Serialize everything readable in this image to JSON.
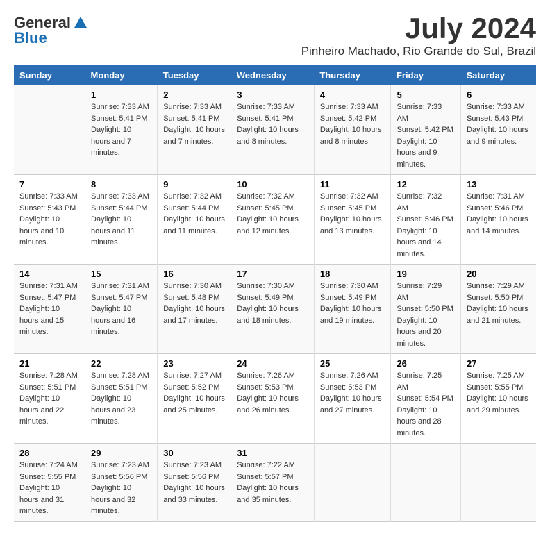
{
  "logo": {
    "general": "General",
    "blue": "Blue"
  },
  "title": {
    "month": "July 2024",
    "location": "Pinheiro Machado, Rio Grande do Sul, Brazil"
  },
  "headers": [
    "Sunday",
    "Monday",
    "Tuesday",
    "Wednesday",
    "Thursday",
    "Friday",
    "Saturday"
  ],
  "weeks": [
    [
      {
        "day": "",
        "sunrise": "",
        "sunset": "",
        "daylight": ""
      },
      {
        "day": "1",
        "sunrise": "Sunrise: 7:33 AM",
        "sunset": "Sunset: 5:41 PM",
        "daylight": "Daylight: 10 hours and 7 minutes."
      },
      {
        "day": "2",
        "sunrise": "Sunrise: 7:33 AM",
        "sunset": "Sunset: 5:41 PM",
        "daylight": "Daylight: 10 hours and 7 minutes."
      },
      {
        "day": "3",
        "sunrise": "Sunrise: 7:33 AM",
        "sunset": "Sunset: 5:41 PM",
        "daylight": "Daylight: 10 hours and 8 minutes."
      },
      {
        "day": "4",
        "sunrise": "Sunrise: 7:33 AM",
        "sunset": "Sunset: 5:42 PM",
        "daylight": "Daylight: 10 hours and 8 minutes."
      },
      {
        "day": "5",
        "sunrise": "Sunrise: 7:33 AM",
        "sunset": "Sunset: 5:42 PM",
        "daylight": "Daylight: 10 hours and 9 minutes."
      },
      {
        "day": "6",
        "sunrise": "Sunrise: 7:33 AM",
        "sunset": "Sunset: 5:43 PM",
        "daylight": "Daylight: 10 hours and 9 minutes."
      }
    ],
    [
      {
        "day": "7",
        "sunrise": "Sunrise: 7:33 AM",
        "sunset": "Sunset: 5:43 PM",
        "daylight": "Daylight: 10 hours and 10 minutes."
      },
      {
        "day": "8",
        "sunrise": "Sunrise: 7:33 AM",
        "sunset": "Sunset: 5:44 PM",
        "daylight": "Daylight: 10 hours and 11 minutes."
      },
      {
        "day": "9",
        "sunrise": "Sunrise: 7:32 AM",
        "sunset": "Sunset: 5:44 PM",
        "daylight": "Daylight: 10 hours and 11 minutes."
      },
      {
        "day": "10",
        "sunrise": "Sunrise: 7:32 AM",
        "sunset": "Sunset: 5:45 PM",
        "daylight": "Daylight: 10 hours and 12 minutes."
      },
      {
        "day": "11",
        "sunrise": "Sunrise: 7:32 AM",
        "sunset": "Sunset: 5:45 PM",
        "daylight": "Daylight: 10 hours and 13 minutes."
      },
      {
        "day": "12",
        "sunrise": "Sunrise: 7:32 AM",
        "sunset": "Sunset: 5:46 PM",
        "daylight": "Daylight: 10 hours and 14 minutes."
      },
      {
        "day": "13",
        "sunrise": "Sunrise: 7:31 AM",
        "sunset": "Sunset: 5:46 PM",
        "daylight": "Daylight: 10 hours and 14 minutes."
      }
    ],
    [
      {
        "day": "14",
        "sunrise": "Sunrise: 7:31 AM",
        "sunset": "Sunset: 5:47 PM",
        "daylight": "Daylight: 10 hours and 15 minutes."
      },
      {
        "day": "15",
        "sunrise": "Sunrise: 7:31 AM",
        "sunset": "Sunset: 5:47 PM",
        "daylight": "Daylight: 10 hours and 16 minutes."
      },
      {
        "day": "16",
        "sunrise": "Sunrise: 7:30 AM",
        "sunset": "Sunset: 5:48 PM",
        "daylight": "Daylight: 10 hours and 17 minutes."
      },
      {
        "day": "17",
        "sunrise": "Sunrise: 7:30 AM",
        "sunset": "Sunset: 5:49 PM",
        "daylight": "Daylight: 10 hours and 18 minutes."
      },
      {
        "day": "18",
        "sunrise": "Sunrise: 7:30 AM",
        "sunset": "Sunset: 5:49 PM",
        "daylight": "Daylight: 10 hours and 19 minutes."
      },
      {
        "day": "19",
        "sunrise": "Sunrise: 7:29 AM",
        "sunset": "Sunset: 5:50 PM",
        "daylight": "Daylight: 10 hours and 20 minutes."
      },
      {
        "day": "20",
        "sunrise": "Sunrise: 7:29 AM",
        "sunset": "Sunset: 5:50 PM",
        "daylight": "Daylight: 10 hours and 21 minutes."
      }
    ],
    [
      {
        "day": "21",
        "sunrise": "Sunrise: 7:28 AM",
        "sunset": "Sunset: 5:51 PM",
        "daylight": "Daylight: 10 hours and 22 minutes."
      },
      {
        "day": "22",
        "sunrise": "Sunrise: 7:28 AM",
        "sunset": "Sunset: 5:51 PM",
        "daylight": "Daylight: 10 hours and 23 minutes."
      },
      {
        "day": "23",
        "sunrise": "Sunrise: 7:27 AM",
        "sunset": "Sunset: 5:52 PM",
        "daylight": "Daylight: 10 hours and 25 minutes."
      },
      {
        "day": "24",
        "sunrise": "Sunrise: 7:26 AM",
        "sunset": "Sunset: 5:53 PM",
        "daylight": "Daylight: 10 hours and 26 minutes."
      },
      {
        "day": "25",
        "sunrise": "Sunrise: 7:26 AM",
        "sunset": "Sunset: 5:53 PM",
        "daylight": "Daylight: 10 hours and 27 minutes."
      },
      {
        "day": "26",
        "sunrise": "Sunrise: 7:25 AM",
        "sunset": "Sunset: 5:54 PM",
        "daylight": "Daylight: 10 hours and 28 minutes."
      },
      {
        "day": "27",
        "sunrise": "Sunrise: 7:25 AM",
        "sunset": "Sunset: 5:55 PM",
        "daylight": "Daylight: 10 hours and 29 minutes."
      }
    ],
    [
      {
        "day": "28",
        "sunrise": "Sunrise: 7:24 AM",
        "sunset": "Sunset: 5:55 PM",
        "daylight": "Daylight: 10 hours and 31 minutes."
      },
      {
        "day": "29",
        "sunrise": "Sunrise: 7:23 AM",
        "sunset": "Sunset: 5:56 PM",
        "daylight": "Daylight: 10 hours and 32 minutes."
      },
      {
        "day": "30",
        "sunrise": "Sunrise: 7:23 AM",
        "sunset": "Sunset: 5:56 PM",
        "daylight": "Daylight: 10 hours and 33 minutes."
      },
      {
        "day": "31",
        "sunrise": "Sunrise: 7:22 AM",
        "sunset": "Sunset: 5:57 PM",
        "daylight": "Daylight: 10 hours and 35 minutes."
      },
      {
        "day": "",
        "sunrise": "",
        "sunset": "",
        "daylight": ""
      },
      {
        "day": "",
        "sunrise": "",
        "sunset": "",
        "daylight": ""
      },
      {
        "day": "",
        "sunrise": "",
        "sunset": "",
        "daylight": ""
      }
    ]
  ]
}
